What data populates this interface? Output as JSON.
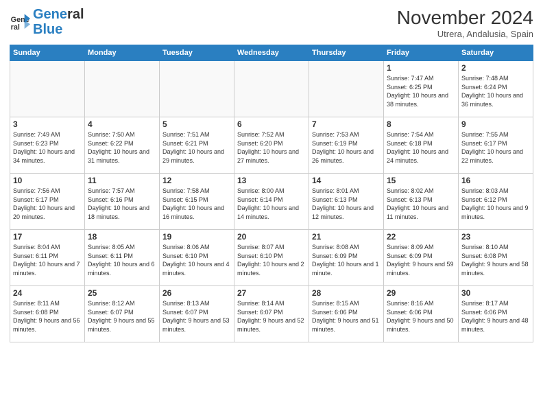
{
  "header": {
    "logo_line1": "General",
    "logo_line2": "Blue",
    "month": "November 2024",
    "location": "Utrera, Andalusia, Spain"
  },
  "weekdays": [
    "Sunday",
    "Monday",
    "Tuesday",
    "Wednesday",
    "Thursday",
    "Friday",
    "Saturday"
  ],
  "weeks": [
    [
      {
        "day": "",
        "empty": true
      },
      {
        "day": "",
        "empty": true
      },
      {
        "day": "",
        "empty": true
      },
      {
        "day": "",
        "empty": true
      },
      {
        "day": "",
        "empty": true
      },
      {
        "day": "1",
        "sunrise": "7:47 AM",
        "sunset": "6:25 PM",
        "daylight": "10 hours and 38 minutes."
      },
      {
        "day": "2",
        "sunrise": "7:48 AM",
        "sunset": "6:24 PM",
        "daylight": "10 hours and 36 minutes."
      }
    ],
    [
      {
        "day": "3",
        "sunrise": "7:49 AM",
        "sunset": "6:23 PM",
        "daylight": "10 hours and 34 minutes."
      },
      {
        "day": "4",
        "sunrise": "7:50 AM",
        "sunset": "6:22 PM",
        "daylight": "10 hours and 31 minutes."
      },
      {
        "day": "5",
        "sunrise": "7:51 AM",
        "sunset": "6:21 PM",
        "daylight": "10 hours and 29 minutes."
      },
      {
        "day": "6",
        "sunrise": "7:52 AM",
        "sunset": "6:20 PM",
        "daylight": "10 hours and 27 minutes."
      },
      {
        "day": "7",
        "sunrise": "7:53 AM",
        "sunset": "6:19 PM",
        "daylight": "10 hours and 26 minutes."
      },
      {
        "day": "8",
        "sunrise": "7:54 AM",
        "sunset": "6:18 PM",
        "daylight": "10 hours and 24 minutes."
      },
      {
        "day": "9",
        "sunrise": "7:55 AM",
        "sunset": "6:17 PM",
        "daylight": "10 hours and 22 minutes."
      }
    ],
    [
      {
        "day": "10",
        "sunrise": "7:56 AM",
        "sunset": "6:17 PM",
        "daylight": "10 hours and 20 minutes."
      },
      {
        "day": "11",
        "sunrise": "7:57 AM",
        "sunset": "6:16 PM",
        "daylight": "10 hours and 18 minutes."
      },
      {
        "day": "12",
        "sunrise": "7:58 AM",
        "sunset": "6:15 PM",
        "daylight": "10 hours and 16 minutes."
      },
      {
        "day": "13",
        "sunrise": "8:00 AM",
        "sunset": "6:14 PM",
        "daylight": "10 hours and 14 minutes."
      },
      {
        "day": "14",
        "sunrise": "8:01 AM",
        "sunset": "6:13 PM",
        "daylight": "10 hours and 12 minutes."
      },
      {
        "day": "15",
        "sunrise": "8:02 AM",
        "sunset": "6:13 PM",
        "daylight": "10 hours and 11 minutes."
      },
      {
        "day": "16",
        "sunrise": "8:03 AM",
        "sunset": "6:12 PM",
        "daylight": "10 hours and 9 minutes."
      }
    ],
    [
      {
        "day": "17",
        "sunrise": "8:04 AM",
        "sunset": "6:11 PM",
        "daylight": "10 hours and 7 minutes."
      },
      {
        "day": "18",
        "sunrise": "8:05 AM",
        "sunset": "6:11 PM",
        "daylight": "10 hours and 6 minutes."
      },
      {
        "day": "19",
        "sunrise": "8:06 AM",
        "sunset": "6:10 PM",
        "daylight": "10 hours and 4 minutes."
      },
      {
        "day": "20",
        "sunrise": "8:07 AM",
        "sunset": "6:10 PM",
        "daylight": "10 hours and 2 minutes."
      },
      {
        "day": "21",
        "sunrise": "8:08 AM",
        "sunset": "6:09 PM",
        "daylight": "10 hours and 1 minute."
      },
      {
        "day": "22",
        "sunrise": "8:09 AM",
        "sunset": "6:09 PM",
        "daylight": "9 hours and 59 minutes."
      },
      {
        "day": "23",
        "sunrise": "8:10 AM",
        "sunset": "6:08 PM",
        "daylight": "9 hours and 58 minutes."
      }
    ],
    [
      {
        "day": "24",
        "sunrise": "8:11 AM",
        "sunset": "6:08 PM",
        "daylight": "9 hours and 56 minutes."
      },
      {
        "day": "25",
        "sunrise": "8:12 AM",
        "sunset": "6:07 PM",
        "daylight": "9 hours and 55 minutes."
      },
      {
        "day": "26",
        "sunrise": "8:13 AM",
        "sunset": "6:07 PM",
        "daylight": "9 hours and 53 minutes."
      },
      {
        "day": "27",
        "sunrise": "8:14 AM",
        "sunset": "6:07 PM",
        "daylight": "9 hours and 52 minutes."
      },
      {
        "day": "28",
        "sunrise": "8:15 AM",
        "sunset": "6:06 PM",
        "daylight": "9 hours and 51 minutes."
      },
      {
        "day": "29",
        "sunrise": "8:16 AM",
        "sunset": "6:06 PM",
        "daylight": "9 hours and 50 minutes."
      },
      {
        "day": "30",
        "sunrise": "8:17 AM",
        "sunset": "6:06 PM",
        "daylight": "9 hours and 48 minutes."
      }
    ]
  ]
}
